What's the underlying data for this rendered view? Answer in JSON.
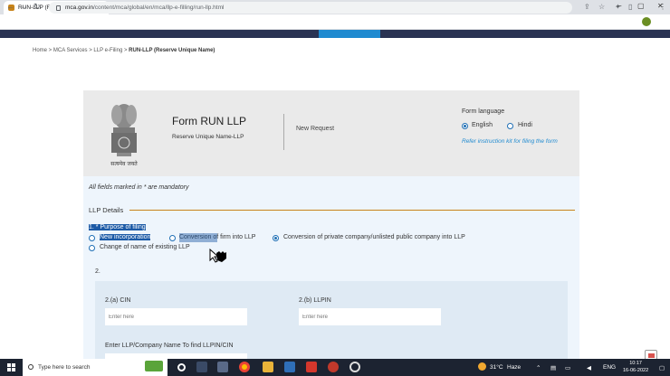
{
  "browser": {
    "tab_title": "RUN-LLP (Reserve Unique Name)",
    "url_host": "mca.gov.in",
    "url_path": "/content/mca/global/en/mca/llp-e-filling/run-llp.html",
    "new_tab": "+",
    "minimize": "−",
    "maximize": "▢",
    "close": "✕",
    "back": "←",
    "forward": "→",
    "reload": "↻",
    "more": "⋮"
  },
  "breadcrumb": {
    "home": "Home",
    "sep": " > ",
    "mca_services": "MCA Services",
    "llp_efiling": "LLP e-Filing",
    "current": "RUN-LLP (Reserve Unique Name)"
  },
  "header": {
    "emblem_caption": "सत्यमेव जयते",
    "form_title": "Form RUN LLP",
    "form_subtitle": "Reserve Unique Name-LLP",
    "request_type": "New Request",
    "form_language_label": "Form language",
    "lang_english": "English",
    "lang_hindi": "Hindi",
    "instruction_link": "Refer instruction kit for filing the form"
  },
  "form": {
    "mandatory_note": "All fields marked in * are mandatory",
    "section_title": "LLP Details",
    "purpose_label": "1. * Purpose of filing",
    "purpose_options": [
      "New incorporation",
      "Conversion of firm into LLP",
      "Conversion of private company/unlisted public company into LLP",
      "Change of name of existing LLP"
    ],
    "purpose_selected": "Conversion of private company/unlisted public company into LLP",
    "section2_label": "2.",
    "cin_label": "2.(a) CIN",
    "cin_placeholder": "Enter here",
    "llpin_label": "2.(b) LLPIN",
    "llpin_placeholder": "Enter here",
    "name_lookup_label": "Enter LLP/Company Name To find LLPIN/CIN"
  },
  "taskbar": {
    "search_placeholder": "Type here to search",
    "temperature": "31°C",
    "weather": "Haze",
    "language": "ENG",
    "time": "10:17",
    "date": "16-06-2022"
  },
  "colors": {
    "nav_bar": "#2a3353",
    "nav_active": "#1f8ad0",
    "accent_line": "#c8841a",
    "selection": "#1c5aa6",
    "radio": "#1f6fb5"
  }
}
